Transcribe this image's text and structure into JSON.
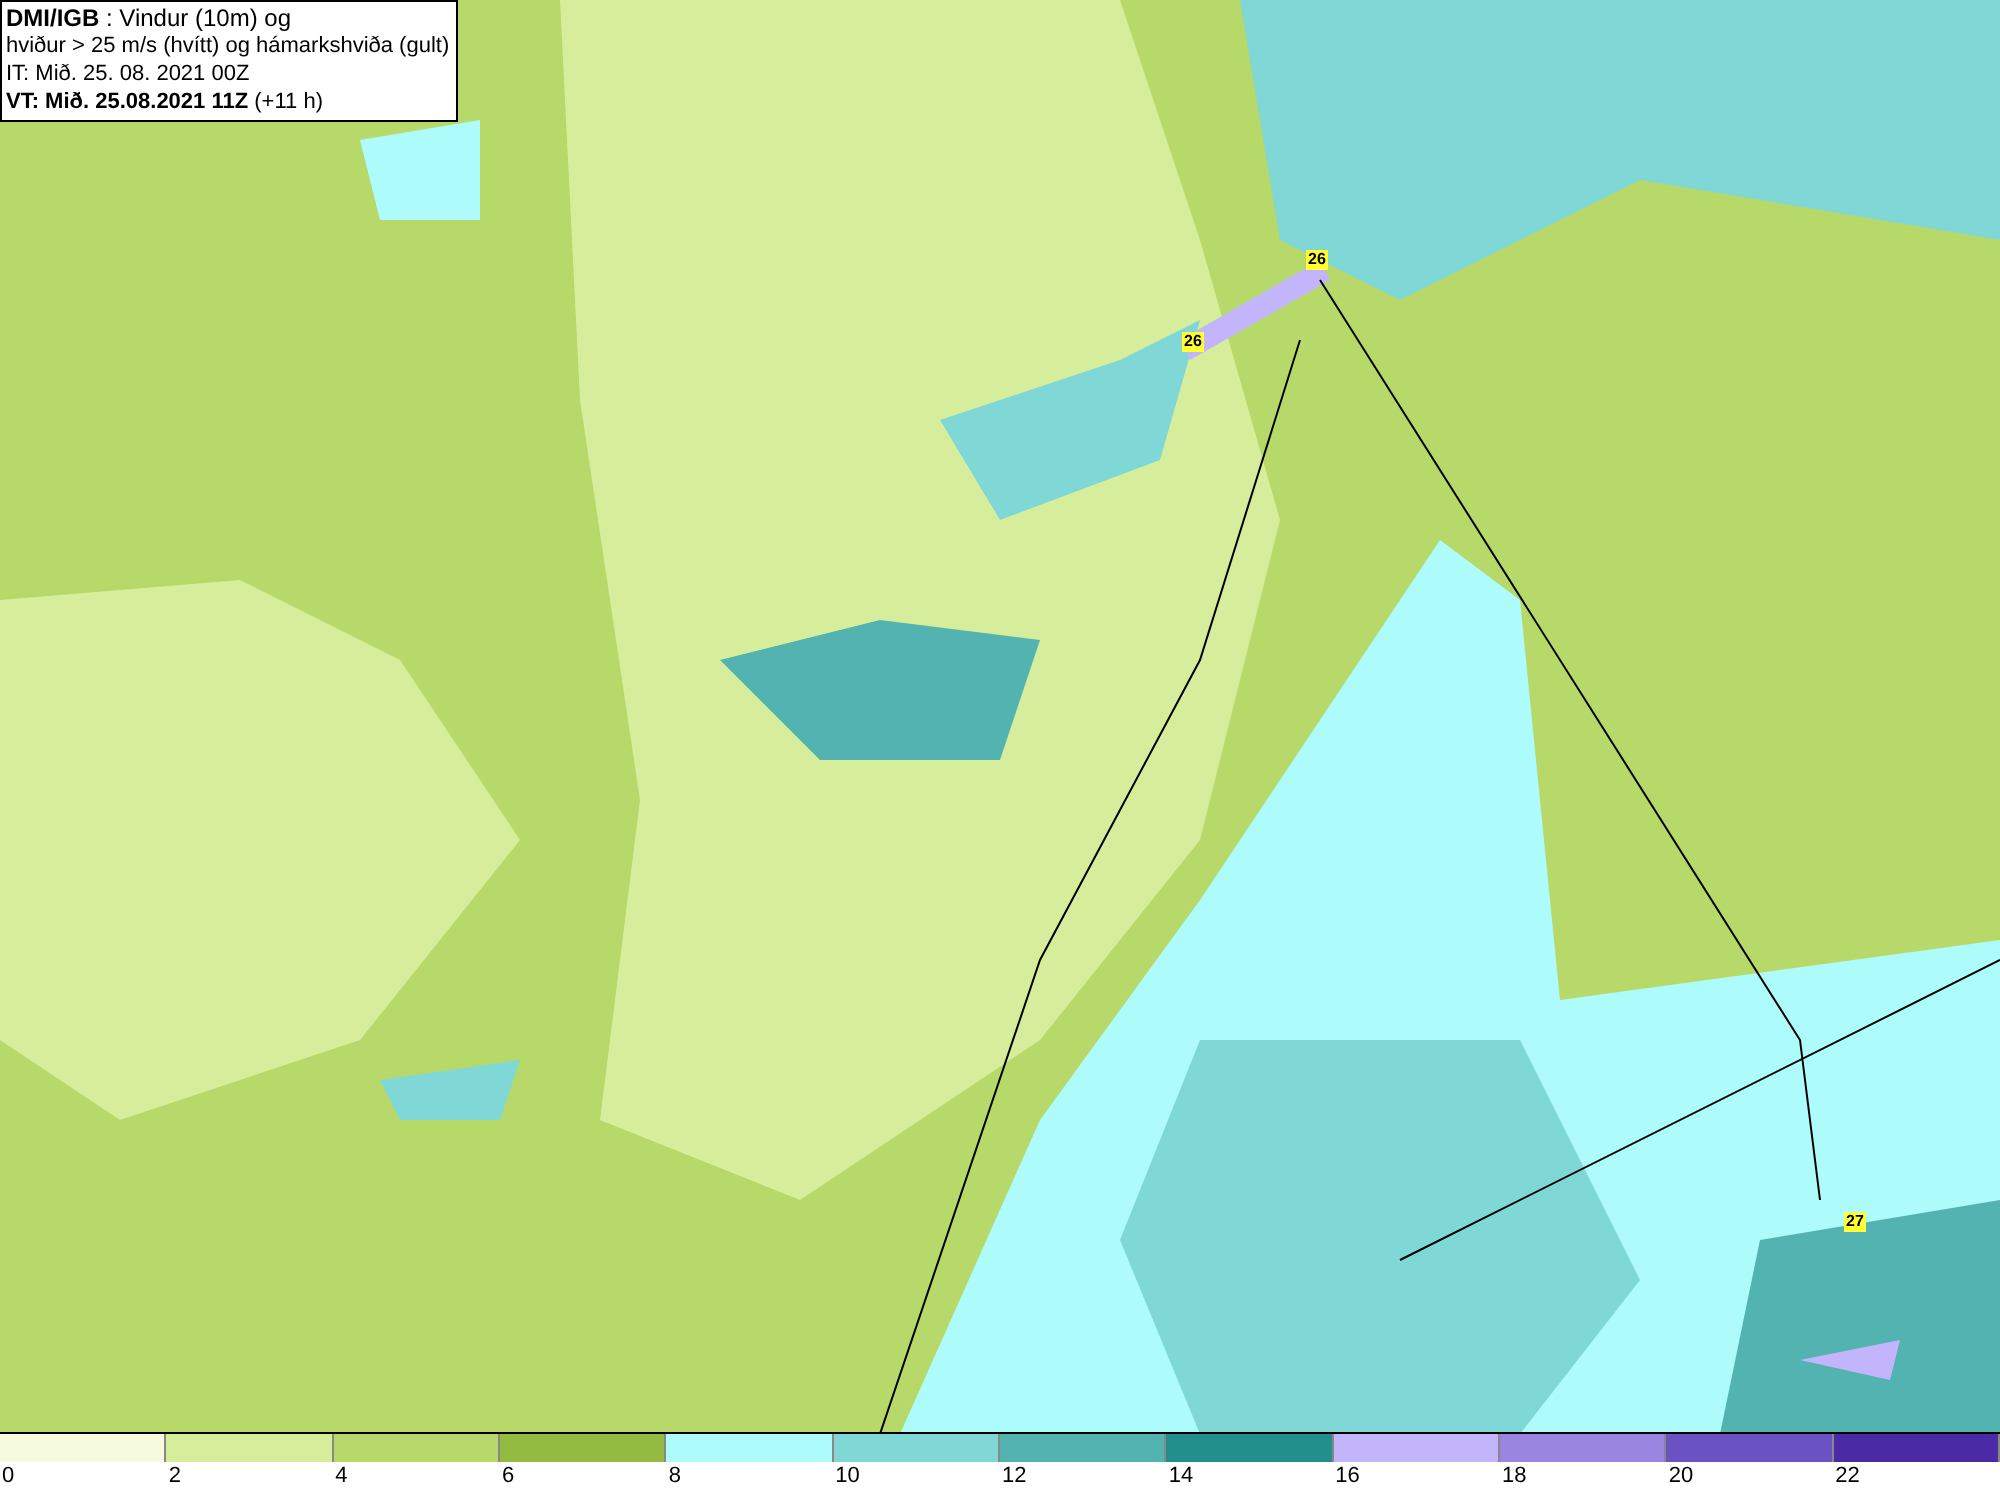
{
  "info_box": {
    "lines": [
      "**DMI/IGB** : Vindur (10m) og",
      "hviður > 25 m/s (hvítt) og hámarkshviða (gult)",
      "IT: Mið. 25. 08. 2021 00Z",
      "**VT: Mið. 25.08.2021 11Z** (+11 h)"
    ]
  },
  "gust_labels": [
    "26",
    "26",
    "27"
  ],
  "legend": [
    {
      "label": "0",
      "color": "#f5fbdc"
    },
    {
      "label": "2",
      "color": "#d6ee9b"
    },
    {
      "label": "4",
      "color": "#b6d96a"
    },
    {
      "label": "6",
      "color": "#94bb41"
    },
    {
      "label": "8",
      "color": "#adfbfb"
    },
    {
      "label": "10",
      "color": "#7fd8d6"
    },
    {
      "label": "12",
      "color": "#53b3b1"
    },
    {
      "label": "14",
      "color": "#238f8c"
    },
    {
      "label": "16",
      "color": "#c3b5fb"
    },
    {
      "label": "18",
      "color": "#9a86e0"
    },
    {
      "label": "20",
      "color": "#6a52c2"
    },
    {
      "label": "22",
      "color": "#4a2aa5"
    }
  ]
}
